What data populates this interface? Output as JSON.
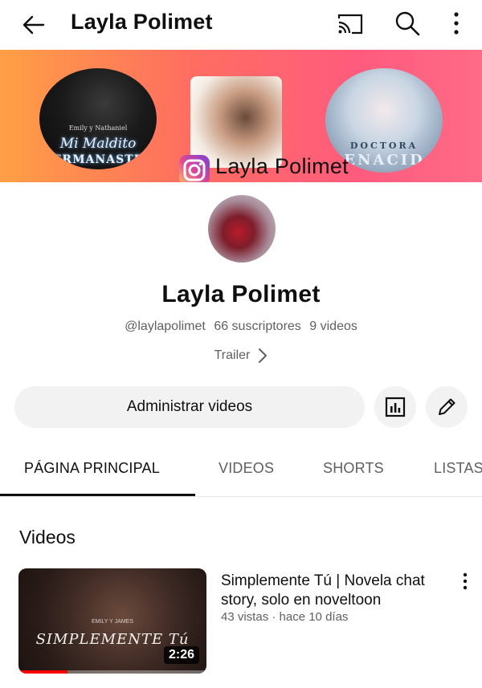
{
  "header": {
    "title": "Layla Polimet",
    "icons": {
      "back": "arrow-left",
      "cast": "cast",
      "search": "search",
      "more": "more-vertical"
    }
  },
  "banner": {
    "handle": "Layla Polimet",
    "covers": [
      {
        "small": "Emily y Nathaniel",
        "title": "Mi Maldito",
        "subtitle": "HERMANASTRO"
      },
      {
        "small": "",
        "title": "",
        "subtitle": ""
      },
      {
        "small": "DOCTORA",
        "title": "RENACIDA",
        "subtitle": ""
      }
    ]
  },
  "channel": {
    "name": "Layla Polimet",
    "handle": "@laylapolimet",
    "subscribers": "66 suscriptores",
    "videos": "9 videos",
    "trailer": "Trailer"
  },
  "actions": {
    "manage_label": "Administrar videos"
  },
  "tabs": [
    {
      "label": "PÁGINA PRINCIPAL",
      "active": true
    },
    {
      "label": "VIDEOS",
      "active": false
    },
    {
      "label": "SHORTS",
      "active": false
    },
    {
      "label": "LISTAS",
      "active": false
    }
  ],
  "section": {
    "title": "Videos"
  },
  "videos": [
    {
      "title": "Simplemente Tú | Novela chat story, solo en noveltoon",
      "meta": "43 vistas · hace 10 días",
      "duration": "2:26",
      "thumb_small": "EMILY Y JAMES",
      "thumb_title": "SIMPLEMENTE Tú",
      "watch_progress": 0.26
    }
  ],
  "colors": {
    "accent_red": "#ff0000",
    "banner_start": "#ff9f45",
    "banner_end": "#ff6b86"
  }
}
